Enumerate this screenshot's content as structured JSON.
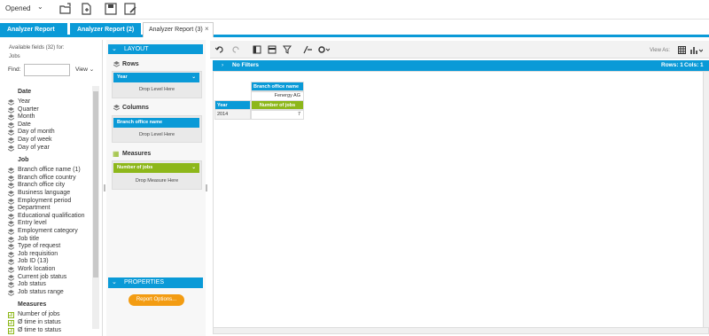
{
  "toolbar": {
    "opened_label": "Opened"
  },
  "tabs": [
    "Analyzer Report",
    "Analyzer Report (2)",
    "Analyzer Report (3)"
  ],
  "tab_close": "×",
  "left": {
    "available": "Available fields (32) for:",
    "source": "Jobs",
    "find_label": "Find:",
    "view_label": "View",
    "groups": [
      {
        "name": "Date",
        "fields": [
          "Year",
          "Quarter",
          "Month",
          "Date",
          "Day of month",
          "Day of week",
          "Day of year"
        ]
      },
      {
        "name": "Job",
        "fields": [
          "Branch office name (1)",
          "Branch office country",
          "Branch office city",
          "Business language",
          "Employment period",
          "Department",
          "Educational qualification",
          "Entry level",
          "Employment category",
          "Job title",
          "Type of request",
          "Job requisition",
          "Job ID (13)",
          "Work location",
          "Current job status",
          "Job status",
          "Job status range"
        ]
      },
      {
        "name": "Measures",
        "fields": [
          "Number of jobs",
          "Ø time in status",
          "Ø time to status"
        ]
      }
    ]
  },
  "layout": {
    "title": "LAYOUT",
    "rows_label": "Rows",
    "rows_chip": "Year",
    "columns_label": "Columns",
    "columns_chip": "Branch office name",
    "measures_label": "Measures",
    "measures_chip": "Number of jobs",
    "drop_level": "Drop Level Here",
    "drop_measure": "Drop Measure Here",
    "properties": "PROPERTIES",
    "report_options": "Report Options..."
  },
  "report": {
    "view_as": "View As:",
    "no_filters": "No Filters",
    "rows_count": "Rows: 1",
    "cols_count": "Cols: 1",
    "col_header": "Branch office name",
    "col_value": "Fenergy AG",
    "row_header": "Year",
    "measure_header": "Number of jobs",
    "row_value": "2014",
    "cell_value": "7"
  },
  "colors": {
    "accent": "#0a9ad7",
    "measure": "#8db71a"
  }
}
